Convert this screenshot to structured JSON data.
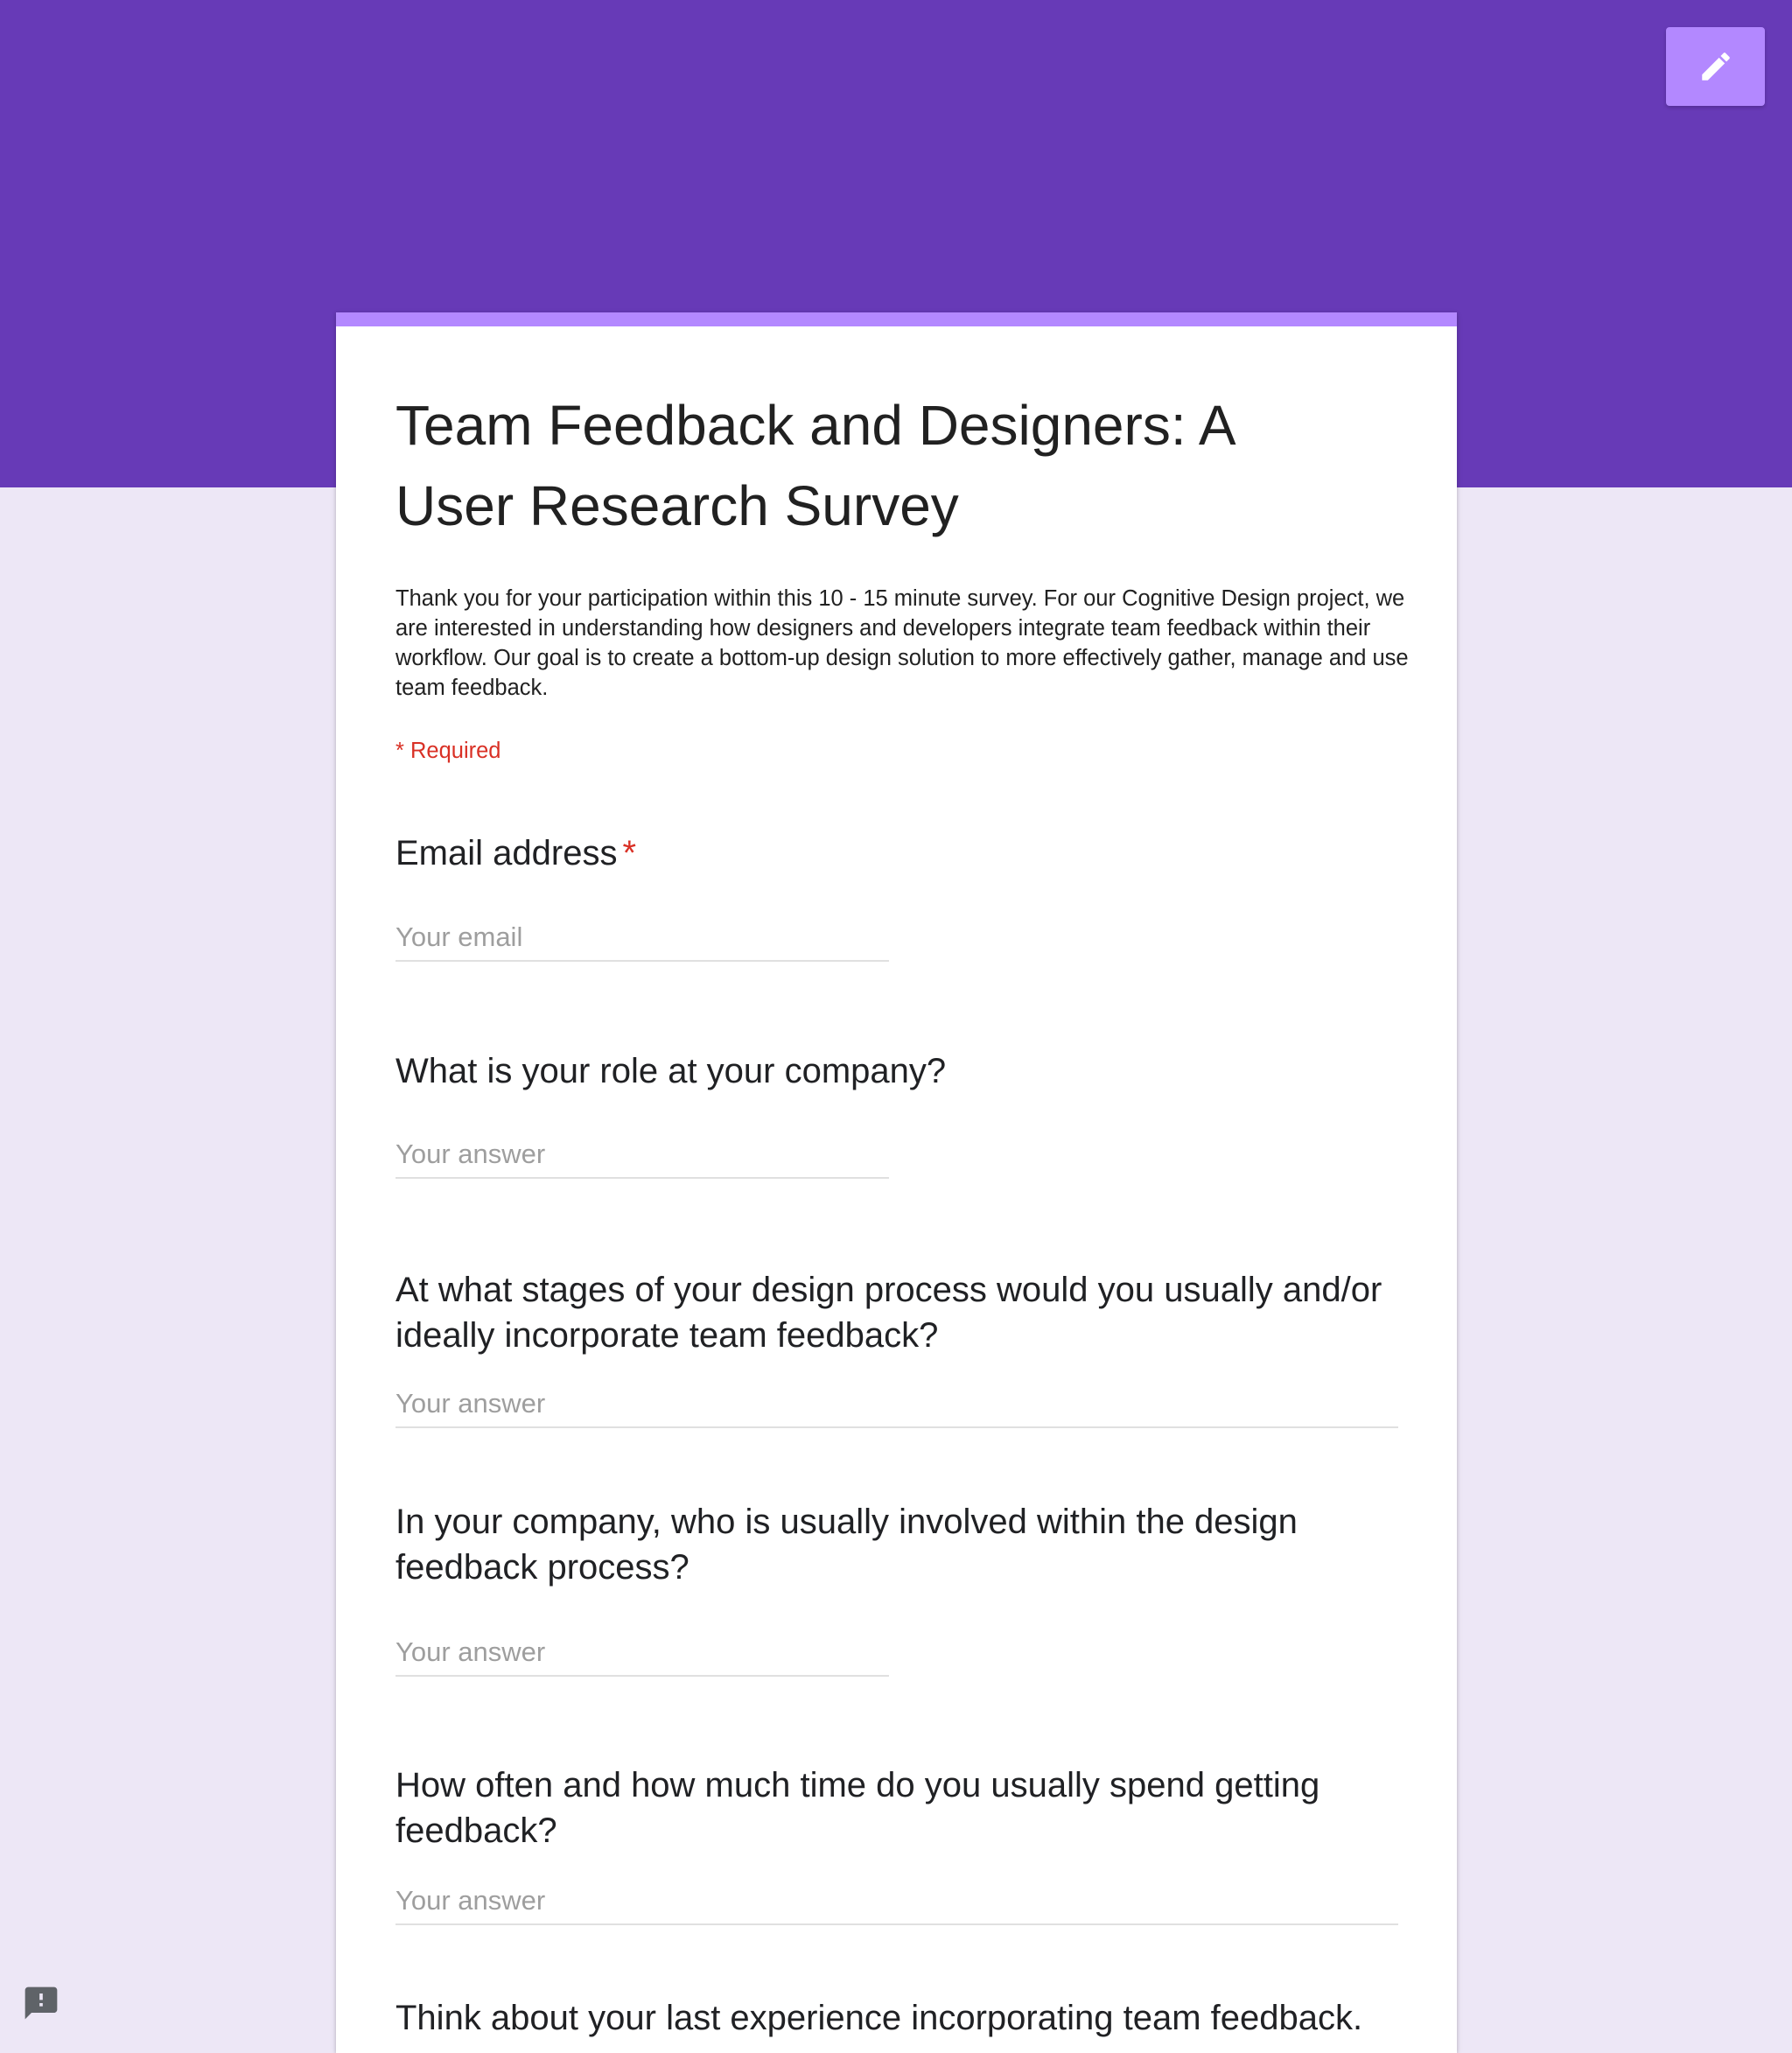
{
  "form": {
    "title": "Team Feedback and Designers: A User Research Survey",
    "description": "Thank you for your participation within this 10 - 15 minute survey. For our Cognitive Design project, we are interested in understanding how designers and developers integrate team feedback within their workflow. Our goal is to create a bottom-up design solution to more effectively gather, manage and use team feedback.",
    "required_note": "* Required"
  },
  "questions": [
    {
      "title": "Email address",
      "required_mark": "*",
      "placeholder": "Your email"
    },
    {
      "title": "What is your role at your company?",
      "placeholder": "Your answer"
    },
    {
      "title": "At what stages of your design process would you usually and/or ideally incorporate team feedback?",
      "placeholder": "Your answer"
    },
    {
      "title": "In your company, who is usually involved within the design feedback process?",
      "placeholder": "Your answer"
    },
    {
      "title": "How often and how much time do you usually spend getting feedback?",
      "placeholder": "Your answer"
    },
    {
      "title": "Think about your last experience incorporating team feedback."
    }
  ],
  "icons": {
    "edit": "pencil-icon",
    "report": "report-problem-icon"
  },
  "colors": {
    "header": "#673ab7",
    "accent": "#b388ff",
    "background": "#ede7f6",
    "required": "#d93025"
  }
}
